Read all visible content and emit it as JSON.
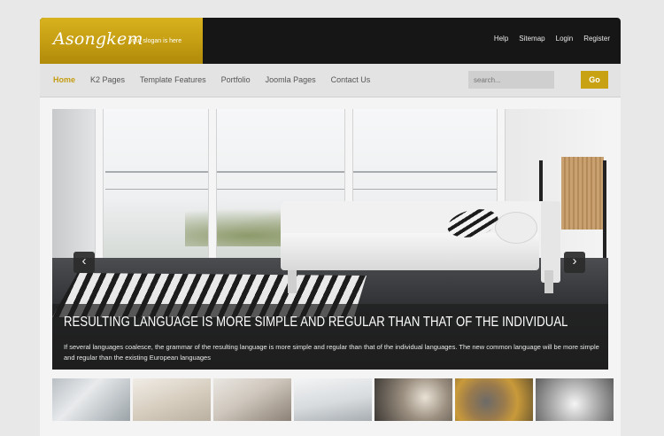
{
  "header": {
    "logo": "Asongkem",
    "slogan": "your slogan is here",
    "top_links": [
      "Help",
      "Sitemap",
      "Login",
      "Register"
    ]
  },
  "nav": {
    "items": [
      "Home",
      "K2 Pages",
      "Template Features",
      "Portfolio",
      "Joomla Pages",
      "Contact Us"
    ],
    "active": "Home",
    "search_placeholder": "search...",
    "go_label": "Go"
  },
  "slideshow": {
    "prev_icon": "chevron-left-icon",
    "next_icon": "chevron-right-icon",
    "prev_glyph": "‹",
    "next_glyph": "›",
    "caption_title": "RESULTING LANGUAGE IS MORE SIMPLE AND REGULAR THAN THAT OF THE INDIVIDUAL",
    "caption_text": "If several languages coalesce, the grammar of the resulting language is more simple and regular than that of the individual languages. The new common language will be more simple and regular than the existing European languages"
  },
  "thumbnails": 7,
  "colors": {
    "accent": "#c9a214",
    "header_bg": "#161616",
    "nav_bg": "#e3e3e3"
  }
}
